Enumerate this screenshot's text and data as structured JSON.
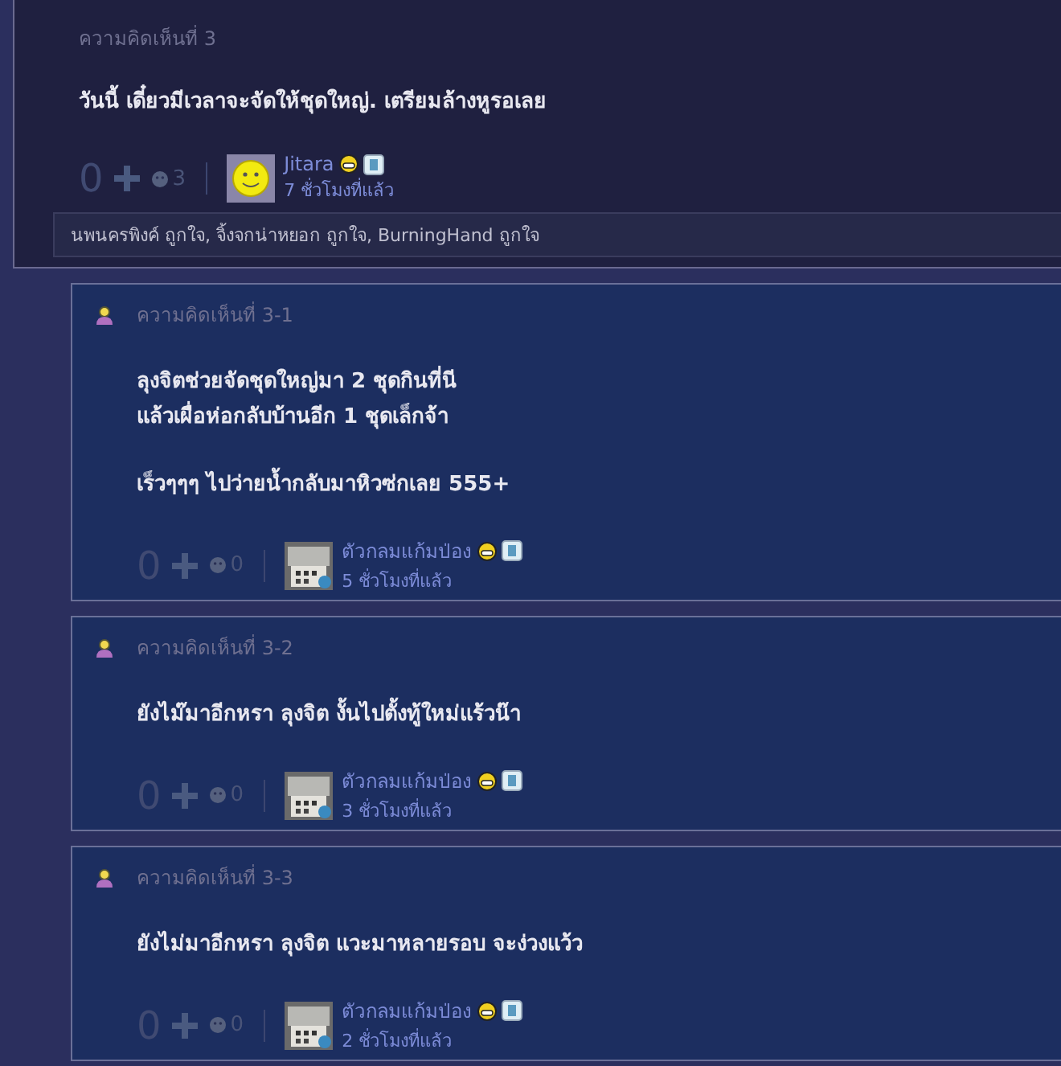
{
  "comment": {
    "number": "ความคิดเห็นที่ 3",
    "paragraphs": [
      [
        "วันนี้ เดี๋ยวมีเวลาจะจัดให้ชุดใหญ่. เตรียมล้างหูรอเลย"
      ]
    ],
    "votes": "0",
    "emotions": "3",
    "author": "Jitara",
    "time": "7 ชั่วโมงที่แล้ว",
    "likes": "นพนครพิงค์ ถูกใจ, จิ้งจกน่าหยอก ถูกใจ, BurningHand ถูกใจ"
  },
  "replies": [
    {
      "number": "ความคิดเห็นที่ 3-1",
      "paragraphs": [
        [
          "ลุงจิตช่วยจัดชุดใหญ่มา 2 ชุดกินที่นี",
          "แล้วเผื่อห่อกลับบ้านอีก 1 ชุดเล็กจ้า"
        ],
        [
          "เร็วๆๆๆ ไปว่ายน้ำกลับมาหิวซ่กเลย 555+"
        ]
      ],
      "votes": "0",
      "emotions": "0",
      "author": "ตัวกลมแก้มป่อง",
      "time": "5 ชั่วโมงที่แล้ว"
    },
    {
      "number": "ความคิดเห็นที่ 3-2",
      "paragraphs": [
        [
          "ยังไม๊มาอีกหรา ลุงจิต งั้นไปตั้งทู้ใหม่แร้วน๊า"
        ]
      ],
      "votes": "0",
      "emotions": "0",
      "author": "ตัวกลมแก้มป่อง",
      "time": "3 ชั่วโมงที่แล้ว"
    },
    {
      "number": "ความคิดเห็นที่ 3-3",
      "paragraphs": [
        [
          "ยังไม่มาอีกหรา ลุงจิต แวะมาหลายรอบ จะง่วงแว้ว"
        ]
      ],
      "votes": "0",
      "emotions": "0",
      "author": "ตัวกลมแก้มป่อง",
      "time": "2 ชั่วโมงที่แล้ว"
    }
  ]
}
